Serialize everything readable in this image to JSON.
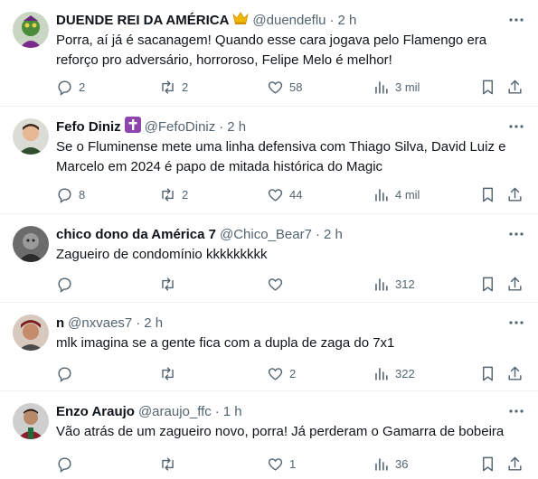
{
  "tweets": [
    {
      "name": "DUENDE REI DA AMÉRICA",
      "badge": "crown-emoji",
      "handle": "@duendeflu",
      "separator": "·",
      "time": "2 h",
      "text": "Porra, aí já é sacanagem! Quando esse cara jogava pelo Flamengo era reforço pro adversário, horroroso, Felipe Melo é melhor!",
      "replies": "2",
      "retweets": "2",
      "likes": "58",
      "views": "3 mil"
    },
    {
      "name": "Fefo Diniz",
      "badge": "cross-emoji",
      "handle": "@FefoDiniz",
      "separator": "·",
      "time": "2 h",
      "text": "Se o Fluminense mete uma linha defensiva com Thiago Silva, David Luiz e Marcelo em 2024 é papo de mitada histórica do Magic",
      "replies": "8",
      "retweets": "2",
      "likes": "44",
      "views": "4 mil"
    },
    {
      "name": "chico dono da América 7",
      "handle": "@Chico_Bear7",
      "separator": "·",
      "time": "2 h",
      "text": "Zagueiro de condomínio  kkkkkkkkk",
      "replies": "",
      "retweets": "",
      "likes": "",
      "views": "312"
    },
    {
      "name": "n",
      "handle": "@nxvaes7",
      "separator": "·",
      "time": "2 h",
      "text": "mlk imagina se a gente fica com a dupla de zaga do 7x1",
      "replies": "",
      "retweets": "",
      "likes": "2",
      "views": "322"
    },
    {
      "name": "Enzo Araujo",
      "handle": "@araujo_ffc",
      "separator": "·",
      "time": "1 h",
      "text": "Vão atrás de um zagueiro novo, porra! Já perderam o Gamarra de bobeira",
      "replies": "",
      "retweets": "",
      "likes": "1",
      "views": "36"
    }
  ],
  "colors": {
    "text": "#0f1419",
    "muted": "#536471",
    "divider": "#eff3f4",
    "badge_purple": "#8e44ad",
    "crown_gold": "#f2b705"
  }
}
